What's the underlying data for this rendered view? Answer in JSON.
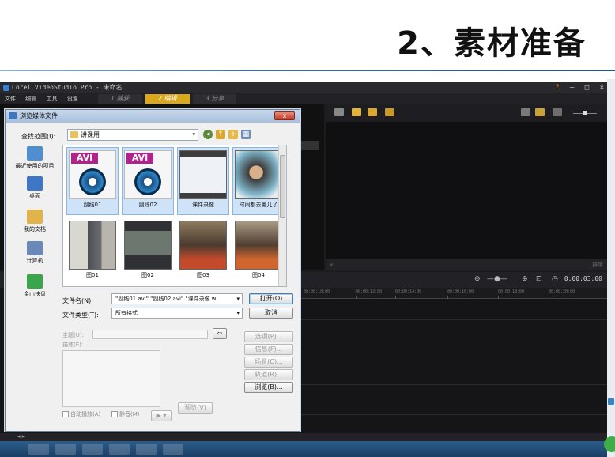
{
  "slide": {
    "title": "2、素材准备"
  },
  "app": {
    "title": "Corel VideoStudio Pro - 未命名",
    "window_controls": [
      "?",
      "–",
      "□",
      "×"
    ],
    "menu": [
      "文件",
      "编辑",
      "工具",
      "设置"
    ],
    "steps": [
      {
        "num": "1",
        "label": "捕获",
        "active": false
      },
      {
        "num": "2",
        "label": "编辑",
        "active": true
      },
      {
        "num": "3",
        "label": "分享",
        "active": false
      }
    ],
    "timeline": {
      "timecode": "0:00:03:00",
      "ruler_ticks": [
        "00:00:10:00",
        "00:00:12:00",
        "00:00:14:00",
        "00:00:16:00",
        "00:00:18:00",
        "00:00:20:00"
      ]
    },
    "library_footer": "排序"
  },
  "dialog": {
    "title": "浏览媒体文件",
    "close": "x",
    "look_in_label": "查找范围(I):",
    "look_in_value": "讲课用",
    "places": [
      {
        "label": "最近使用的项目",
        "color": "#4f8fd0"
      },
      {
        "label": "桌面",
        "color": "#3f76c6"
      },
      {
        "label": "我的文档",
        "color": "#e0b44a"
      },
      {
        "label": "计算机",
        "color": "#6a89b8"
      },
      {
        "label": "金山快盘",
        "color": "#3aa54b"
      }
    ],
    "files": [
      {
        "name": "副线01",
        "kind": "avi",
        "tag": "AVI",
        "selected": true
      },
      {
        "name": "副线02",
        "kind": "avi",
        "tag": "AVI",
        "selected": true
      },
      {
        "name": "课件录像",
        "kind": "video",
        "selected": true
      },
      {
        "name": "时间都去哪儿了",
        "kind": "person",
        "selected": true
      },
      {
        "name": "图01",
        "kind": "classroom",
        "selected": false
      },
      {
        "name": "图02",
        "kind": "screen",
        "selected": false
      },
      {
        "name": "图03",
        "kind": "crowd",
        "selected": false
      },
      {
        "name": "图04",
        "kind": "crowd2",
        "selected": false
      }
    ],
    "filename_label": "文件名(N):",
    "filename_value": "\"副线01.avi\" \"副线02.avi\" \"课件录像.w",
    "filetype_label": "文件类型(T):",
    "filetype_value": "所有格式",
    "open_button": "打开(O)",
    "cancel_button": "取消",
    "subject_label": "主题(U):",
    "description_label": "描述(E):",
    "options_button": "选项(P)...",
    "info_button": "信息(F)...",
    "scene_button": "场景(C)...",
    "subtitle_button": "轨道(R)...",
    "browse_button": "浏览(B)...",
    "preview_button": "预览(V)",
    "autoplay_label": "自动播放(A)",
    "mute_label": "静音(M)",
    "play_glyph": "▶ ▾"
  }
}
